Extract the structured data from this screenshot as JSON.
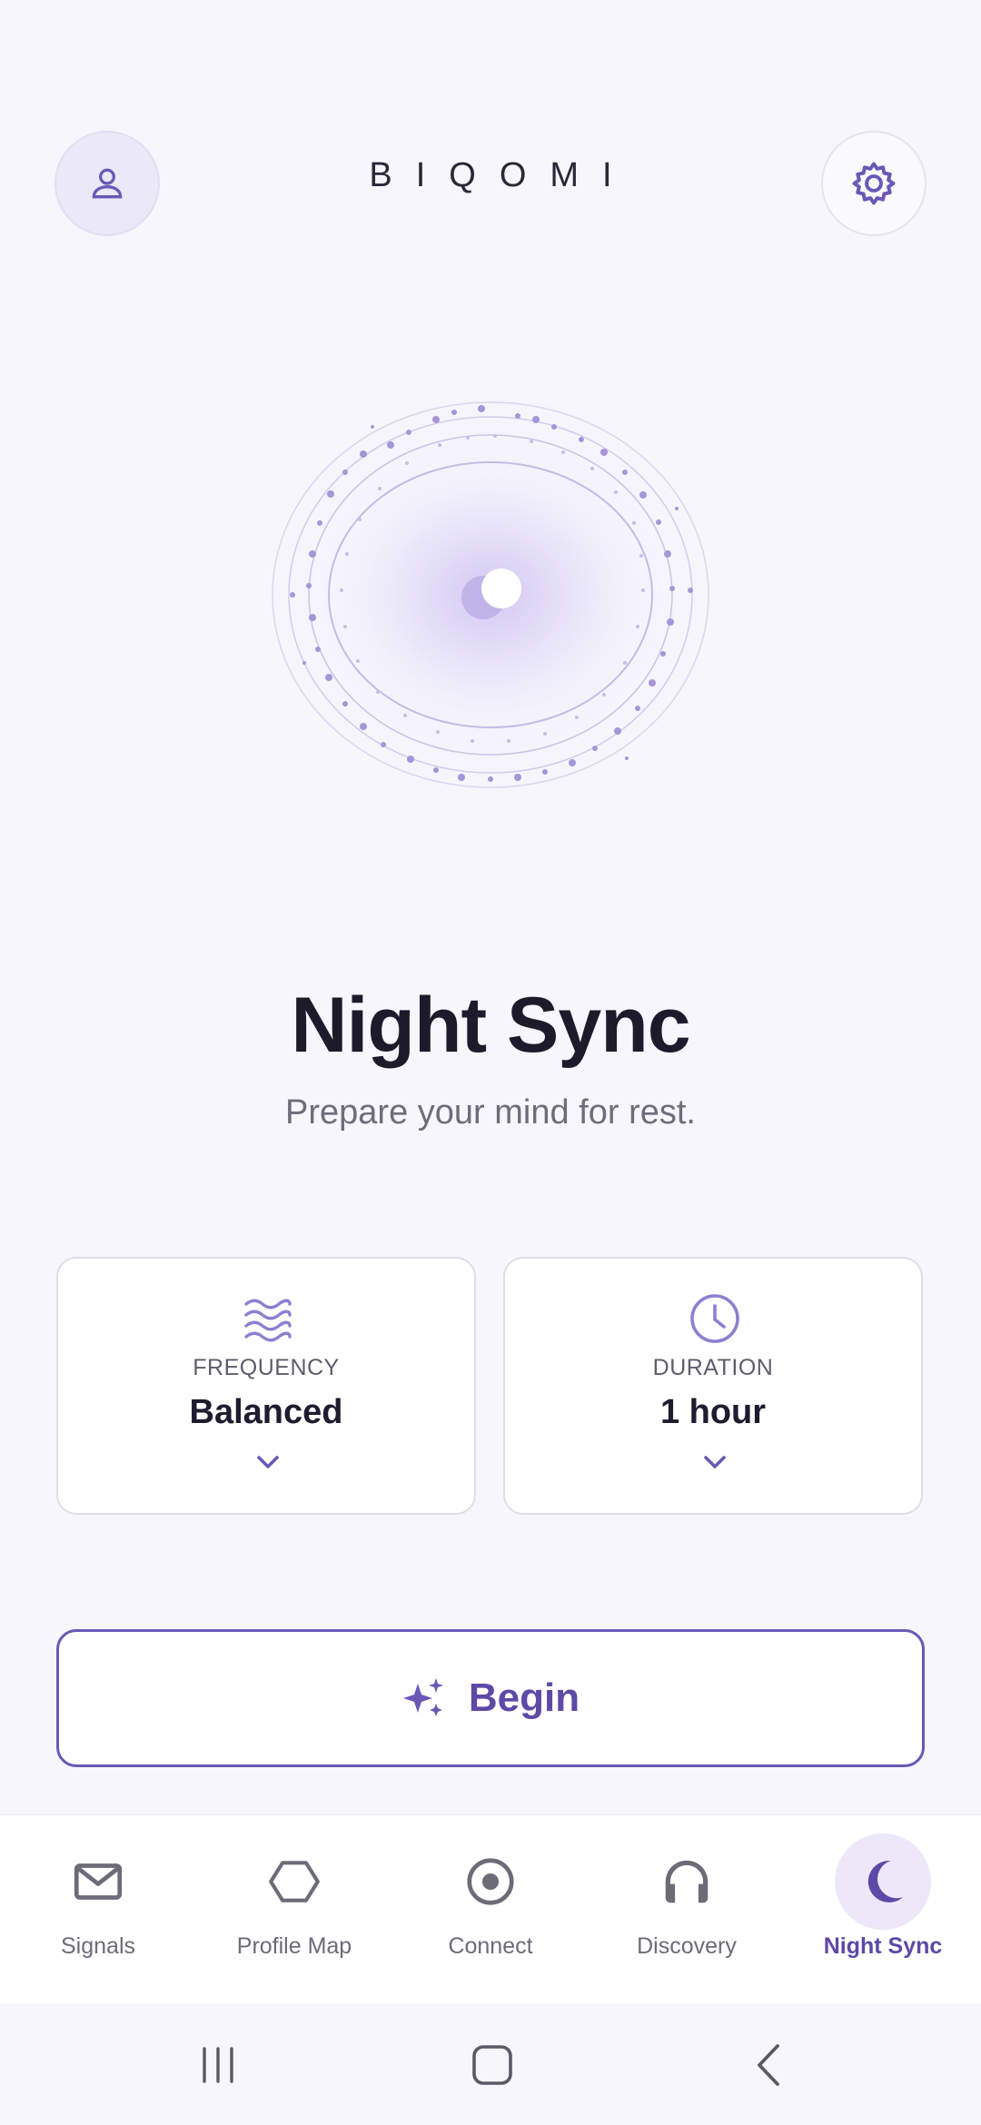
{
  "app": {
    "brand": "BIQOMI",
    "accent_color": "#5c4aa6",
    "profile_icon": "person-icon",
    "settings_icon": "gear-icon"
  },
  "hero": {
    "title": "Night Sync",
    "subtitle": "Prepare your mind for rest."
  },
  "options": [
    {
      "icon": "waves-icon",
      "label": "FREQUENCY",
      "value": "Balanced"
    },
    {
      "icon": "clock-icon",
      "label": "DURATION",
      "value": "1 hour"
    }
  ],
  "begin": {
    "icon": "sparkles-icon",
    "label": "Begin"
  },
  "nav": {
    "items": [
      {
        "icon": "envelope-icon",
        "label": "Signals"
      },
      {
        "icon": "hexagon-icon",
        "label": "Profile Map"
      },
      {
        "icon": "target-icon",
        "label": "Connect"
      },
      {
        "icon": "headphones-icon",
        "label": "Discovery"
      },
      {
        "icon": "moon-icon",
        "label": "Night Sync"
      }
    ],
    "active": "Night Sync"
  },
  "system_nav": [
    "recents-icon",
    "home-icon",
    "back-icon"
  ]
}
